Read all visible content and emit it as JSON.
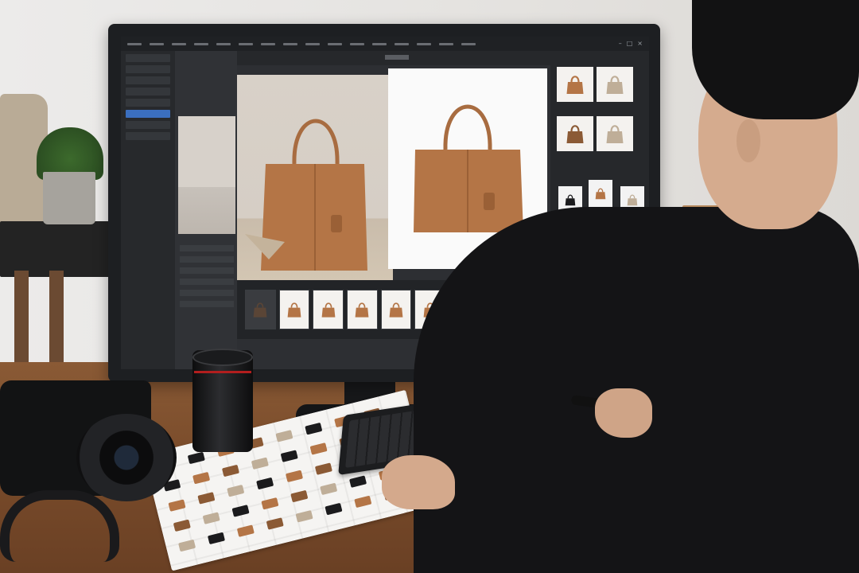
{
  "scene": {
    "description_type": "photo of a person retouching product photos on a desktop monitor",
    "colors": {
      "bag_tan": "#b47546",
      "bag_dark": "#8b5a35",
      "bag_beige": "#bfae98",
      "bag_black": "#1b1b1d",
      "ui_dark": "#2d2f33",
      "ui_accent": "#3b6fbf"
    }
  },
  "screen_ui": {
    "menu_items_count": 16,
    "left_panel_rows": 8,
    "filmstrip_frames": 9,
    "right_panel_thumbs": 4,
    "right_panel_small_items": 9
  },
  "icons": {
    "close": "×",
    "minimize": "–",
    "maximize": "□"
  }
}
